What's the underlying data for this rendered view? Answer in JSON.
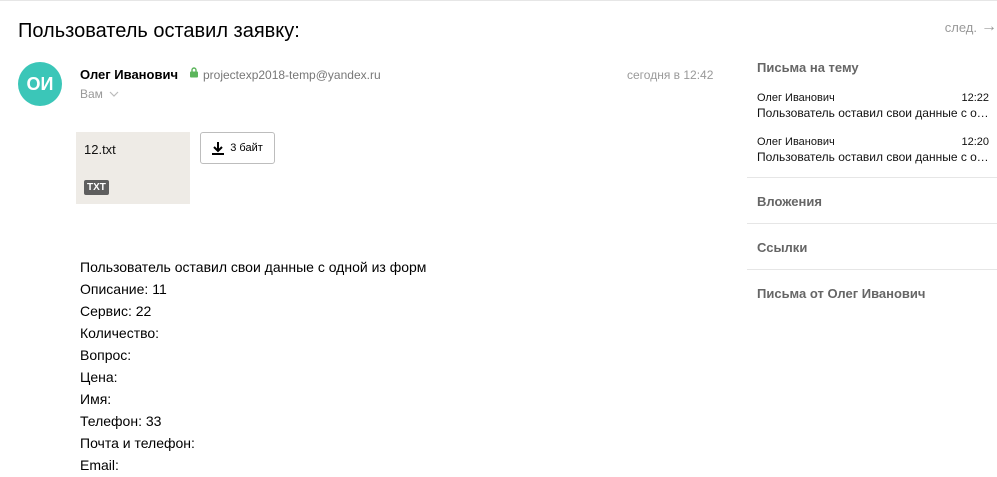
{
  "message": {
    "subject": "Пользователь оставил заявку:",
    "next_label": "след.",
    "avatar_initials": "ОИ",
    "sender_name": "Олег Иванович",
    "sender_email": "projectexp2018-temp@yandex.ru",
    "to_label": "Вам",
    "date": "сегодня в 12:42",
    "attachment": {
      "filename": "12.txt",
      "type_badge": "TXT",
      "size_label": "3 байт"
    },
    "body_lines": [
      "Пользователь оставил свои данные с одной из форм",
      "Описание: 11",
      "Сервис: 22",
      "Количество:",
      "Вопрос:",
      "Цена:",
      "Имя:",
      "Телефон: 33",
      "Почта и телефон:",
      "Email:"
    ]
  },
  "sidebar": {
    "thread_title": "Письма на тему",
    "thread_items": [
      {
        "sender": "Олег Иванович",
        "time": "12:22",
        "preview": "Пользователь оставил свои данные с одной из форм"
      },
      {
        "sender": "Олег Иванович",
        "time": "12:20",
        "preview": "Пользователь оставил свои данные с одной из форм"
      }
    ],
    "attachments_label": "Вложения",
    "links_label": "Ссылки",
    "from_sender_label": "Письма от Олег Иванович"
  },
  "colors": {
    "avatar_bg": "#3bc6b8",
    "lock_icon": "#5bb55b"
  }
}
